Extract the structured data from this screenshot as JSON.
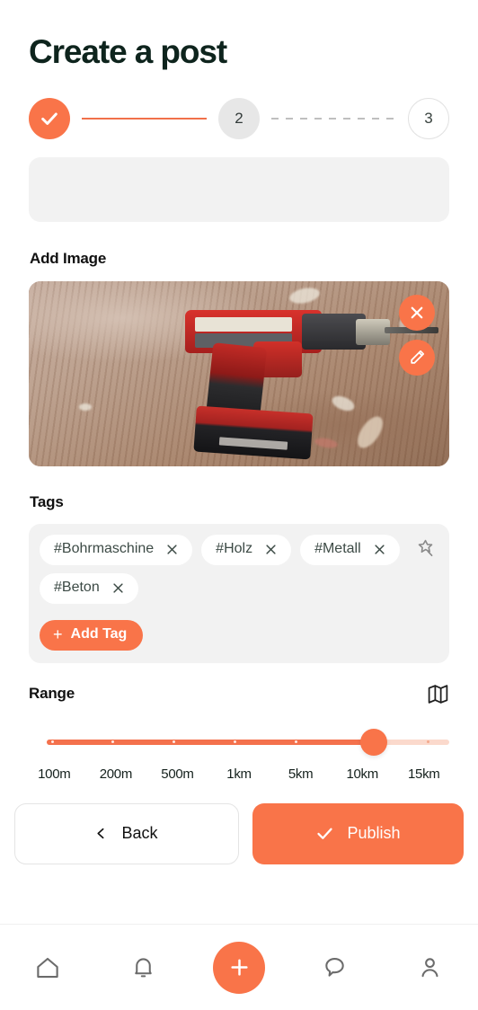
{
  "header": {
    "title": "Create a post"
  },
  "stepper": {
    "steps": [
      {
        "label": "",
        "state": "done",
        "icon": "check-icon"
      },
      {
        "label": "2",
        "state": "current"
      },
      {
        "label": "3",
        "state": "future"
      }
    ]
  },
  "description_field": {
    "value": "",
    "placeholder": ""
  },
  "image_section": {
    "label": "Add Image",
    "photo_alt": "Red cordless drill lying on a wooden surface with debris",
    "remove_icon": "close-icon",
    "edit_icon": "pencil-icon"
  },
  "tags_section": {
    "label": "Tags",
    "magic_icon": "magic-wand-icon",
    "tags": [
      {
        "label": "#Bohrmaschine",
        "remove_icon": "close-icon"
      },
      {
        "label": "#Holz",
        "remove_icon": "close-icon"
      },
      {
        "label": "#Metall",
        "remove_icon": "close-icon"
      },
      {
        "label": "#Beton",
        "remove_icon": "close-icon"
      }
    ],
    "add_tag_label": "Add Tag",
    "add_tag_plus": "+"
  },
  "range_section": {
    "label": "Range",
    "map_icon": "map-icon",
    "ticks": [
      "100m",
      "200m",
      "500m",
      "1km",
      "5km",
      "10km",
      "15km"
    ],
    "selected_value": "10km",
    "selected_index": 5
  },
  "footer": {
    "back_label": "Back",
    "back_icon": "chevron-left-icon",
    "publish_label": "Publish",
    "publish_icon": "check-icon"
  },
  "bottom_nav": {
    "items": [
      {
        "name": "home",
        "icon": "home-icon"
      },
      {
        "name": "notifications",
        "icon": "bell-icon"
      },
      {
        "name": "create",
        "icon": "plus-icon"
      },
      {
        "name": "messages",
        "icon": "chat-bubble-icon"
      },
      {
        "name": "profile",
        "icon": "person-icon"
      }
    ]
  },
  "colors": {
    "accent": "#F97449",
    "accent_track": "#FBD9CC",
    "title": "#0E241D",
    "field_bg": "#F2F2F2",
    "tag_text": "#3C4A45",
    "nav_icon": "#6B6B6B"
  }
}
